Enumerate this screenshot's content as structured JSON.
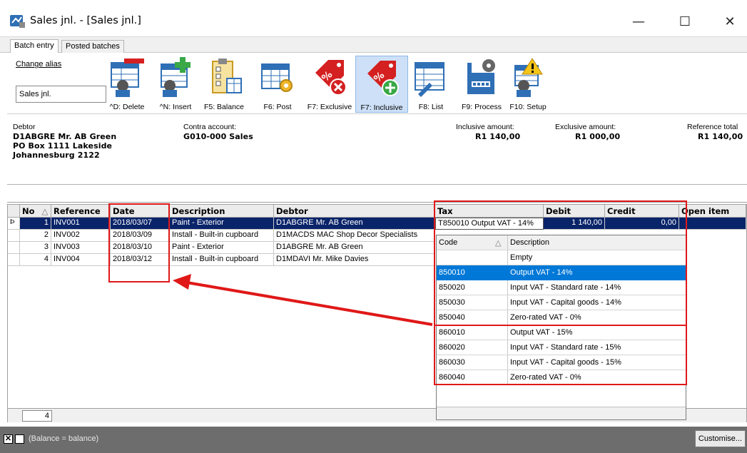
{
  "window": {
    "title": "Sales jnl. - [Sales jnl.]",
    "min_glyph": "—",
    "max_glyph": "☐",
    "close_glyph": "✕"
  },
  "tabs": [
    {
      "label": "Batch entry"
    },
    {
      "label": "Posted batches"
    }
  ],
  "toolbar": {
    "alias_label": "Change alias",
    "alias_value": "Sales jnl.",
    "buttons": [
      {
        "label": "^D: Delete",
        "icon": "delete-icon"
      },
      {
        "label": "^N: Insert",
        "icon": "insert-icon"
      },
      {
        "label": "F5: Balance",
        "icon": "balance-icon"
      },
      {
        "label": "F6: Post",
        "icon": "post-icon"
      },
      {
        "label": "F7: Exclusive",
        "icon": "exclusive-tax-icon"
      },
      {
        "label": "F7: Inclusive",
        "icon": "inclusive-tax-icon"
      },
      {
        "label": "F8: List",
        "icon": "list-icon"
      },
      {
        "label": "F9: Process",
        "icon": "process-icon"
      },
      {
        "label": "F10: Setup",
        "icon": "setup-icon"
      }
    ]
  },
  "info": {
    "debtor_label": "Debtor",
    "debtor_line1": "D1ABGRE Mr. AB Green",
    "debtor_line2": "PO Box 1111 Lakeside",
    "debtor_line3": "Johannesburg 2122",
    "contra_label": "Contra account:",
    "contra_value": "G010-000 Sales",
    "inclusive_label": "Inclusive amount:",
    "inclusive_value": "R1 140,00",
    "exclusive_label": "Exclusive amount:",
    "exclusive_value": "R1 000,00",
    "reference_label": "Reference total",
    "reference_value": "R1 140,00"
  },
  "grid": {
    "headers": {
      "no": "No",
      "sort_glyph": "△",
      "reference": "Reference",
      "date": "Date",
      "description": "Description",
      "debtor": "Debtor",
      "tax": "Tax",
      "debit": "Debit",
      "credit": "Credit",
      "open_item": "Open item"
    },
    "row_pointer": "Þ",
    "rows": [
      {
        "no": "1",
        "reference": "INV001",
        "date": "2018/03/07",
        "description": "Paint - Exterior",
        "debtor": "D1ABGRE Mr. AB Green",
        "tax": "T850010 Output VAT - 14%",
        "debit": "1 140,00",
        "credit": "0,00"
      },
      {
        "no": "2",
        "reference": "INV002",
        "date": "2018/03/09",
        "description": "Install - Built-in cupboard",
        "debtor": "D1MACDS MAC Shop Decor Specialists"
      },
      {
        "no": "3",
        "reference": "INV003",
        "date": "2018/03/10",
        "description": "Paint - Exterior",
        "debtor": "D1ABGRE Mr. AB Green"
      },
      {
        "no": "4",
        "reference": "INV004",
        "date": "2018/03/12",
        "description": "Install - Built-in cupboard",
        "debtor": "D1MDAVI Mr. Mike Davies"
      }
    ],
    "footer_count": "4"
  },
  "tax_dropdown": {
    "header_code": "Code",
    "header_sort": "△",
    "header_description": "Description",
    "rows": [
      {
        "code": "",
        "description": "Empty"
      },
      {
        "code": "850010",
        "description": "Output VAT - 14%"
      },
      {
        "code": "850020",
        "description": "Input VAT - Standard rate - 14%"
      },
      {
        "code": "850030",
        "description": "Input VAT - Capital goods - 14%"
      },
      {
        "code": "850040",
        "description": "Zero-rated VAT - 0%"
      },
      {
        "code": "860010",
        "description": "Output VAT - 15%"
      },
      {
        "code": "860020",
        "description": "Input VAT - Standard rate - 15%"
      },
      {
        "code": "860030",
        "description": "Input VAT - Capital goods - 15%"
      },
      {
        "code": "860040",
        "description": "Zero-rated VAT - 0%"
      }
    ]
  },
  "status": {
    "check1": "✕",
    "text": "(Balance = balance)",
    "customise": "Customise..."
  },
  "colors": {
    "selection": "#0a246a",
    "dropdown_selection": "#0078d7",
    "annotation_red": "#e01818"
  }
}
